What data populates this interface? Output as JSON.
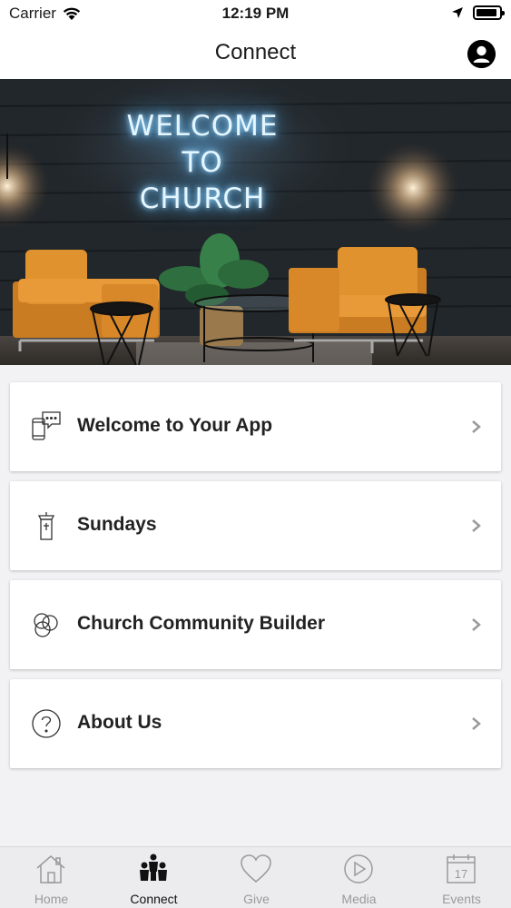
{
  "status_bar": {
    "carrier": "Carrier",
    "time": "12:19 PM",
    "battery_level": 0.92
  },
  "header": {
    "title": "Connect",
    "profile_icon": "user-circle-icon"
  },
  "hero": {
    "neon_line1": "WELCOME",
    "neon_line2": "TO CHURCH"
  },
  "menu": {
    "items": [
      {
        "label": "Welcome to Your App",
        "icon": "chat-phone-icon"
      },
      {
        "label": "Sundays",
        "icon": "pulpit-icon"
      },
      {
        "label": "Church Community Builder",
        "icon": "circles-icon"
      },
      {
        "label": "About Us",
        "icon": "question-circle-icon"
      }
    ]
  },
  "tabs": {
    "items": [
      {
        "label": "Home",
        "icon": "home-icon",
        "active": false
      },
      {
        "label": "Connect",
        "icon": "people-icon",
        "active": true
      },
      {
        "label": "Give",
        "icon": "heart-icon",
        "active": false
      },
      {
        "label": "Media",
        "icon": "play-circle-icon",
        "active": false
      },
      {
        "label": "Events",
        "icon": "calendar-icon",
        "active": false
      }
    ],
    "calendar_day": "17"
  },
  "colors": {
    "accent_active": "#111111",
    "inactive": "#9a9a9a",
    "background": "#f2f2f4",
    "chair": "#e0922e"
  }
}
